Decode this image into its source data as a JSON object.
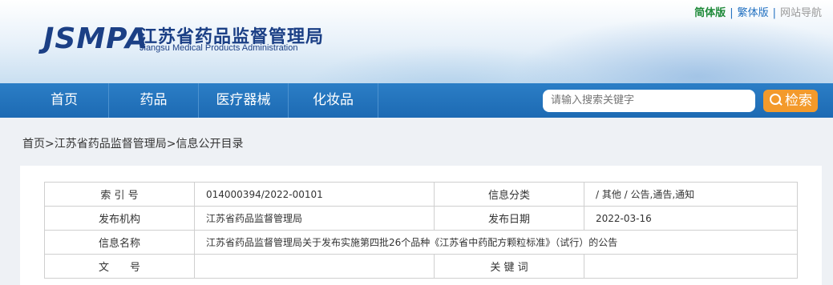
{
  "site": {
    "logo_abbr": "JSMPA",
    "logo_cn": "江苏省药品监督管理局",
    "logo_en": "Jiangsu Medical Products Administration"
  },
  "top_links": {
    "simplified": "简体版",
    "traditional": "繁体版",
    "site_nav": "网站导航",
    "separator": "|"
  },
  "nav": {
    "items": [
      {
        "label": "首页"
      },
      {
        "label": "药品"
      },
      {
        "label": "医疗器械"
      },
      {
        "label": "化妆品"
      }
    ]
  },
  "search": {
    "placeholder": "请输入搜索关键字",
    "button_label": "检索"
  },
  "breadcrumb": {
    "items": [
      "首页",
      "江苏省药品监督管理局",
      "信息公开目录"
    ],
    "separator": ">"
  },
  "info_table": {
    "index_label": "索 引 号",
    "index_value": "014000394/2022-00101",
    "category_label": "信息分类",
    "category_value": "/  其他  /  公告,通告,通知",
    "org_label": "发布机构",
    "org_value": "江苏省药品监督管理局",
    "date_label": "发布日期",
    "date_value": "2022-03-16",
    "name_label": "信息名称",
    "name_value": "江苏省药品监督管理局关于发布实施第四批26个品种《江苏省中药配方颗粒标准》（试行）的公告",
    "doc_no_label": "文　　号",
    "doc_no_value": "",
    "keywords_label": "关 键 词",
    "keywords_value": ""
  },
  "colors": {
    "brand_blue": "#1b3f85",
    "nav_blue": "#1d6ab3",
    "search_orange": "#f39a2b",
    "simplified_green": "#1f8a3a"
  }
}
